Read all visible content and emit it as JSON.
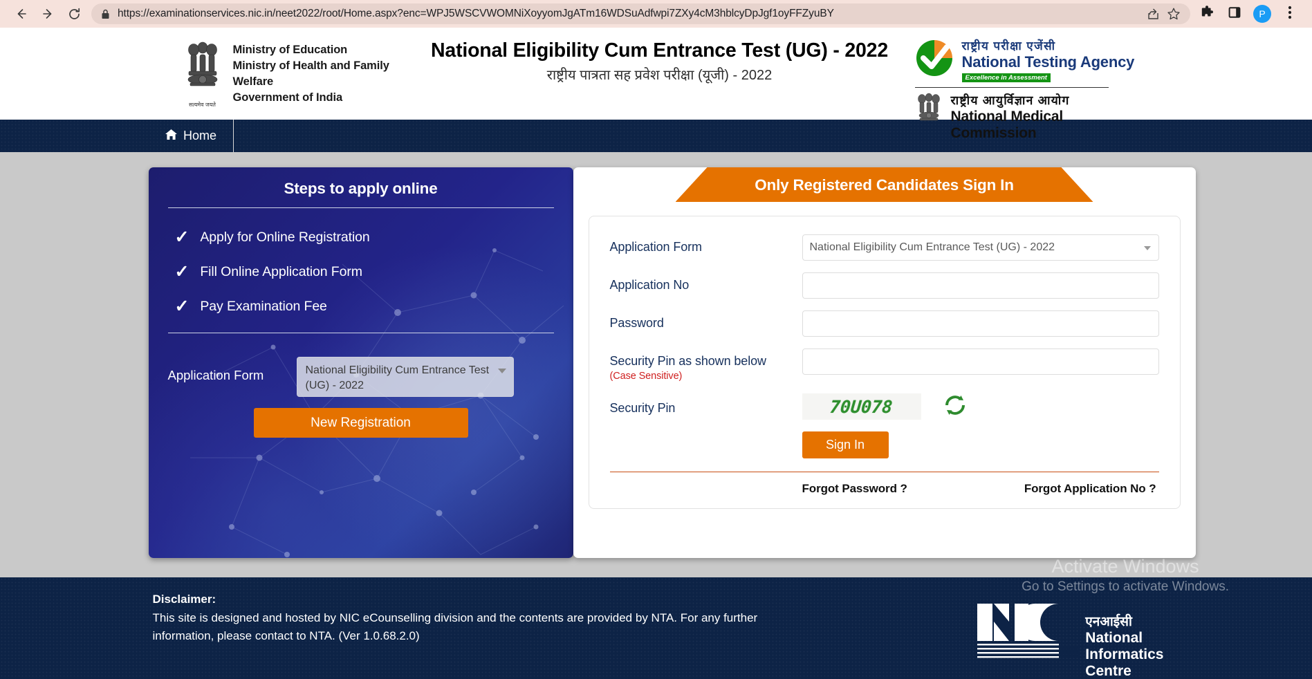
{
  "browser": {
    "url": "https://examinationservices.nic.in/neet2022/root/Home.aspx?enc=WPJ5WSCVWOMNiXoyyomJgATm16WDSuAdfwpi7ZXy4cM3hblcyDpJgf1oyFFZyuBY",
    "back_icon": "back-arrow-icon",
    "forward_icon": "forward-arrow-icon",
    "reload_icon": "reload-icon",
    "lock_icon": "lock-icon",
    "share_icon": "share-icon",
    "bookmark_icon": "star-icon",
    "extensions_icon": "puzzle-icon",
    "sidepanel_icon": "side-panel-icon",
    "profile_initial": "P",
    "menu_icon": "three-dot-menu-icon"
  },
  "header": {
    "ministry_line1": "Ministry of Education",
    "ministry_line2": "Ministry of Health and Family Welfare",
    "ministry_line3": "Government of India",
    "emblem_motto": "सत्यमेव जयते",
    "title_en": "National Eligibility Cum Entrance Test (UG) - 2022",
    "title_hi": "राष्ट्रीय पात्रता सह प्रवेश परीक्षा (यूजी) - 2022",
    "nta_hi": "राष्ट्रीय परीक्षा एजेंसी",
    "nta_en": "National Testing Agency",
    "nta_tagline": "Excellence in Assessment",
    "nmc_hi": "राष्ट्रीय आयुर्विज्ञान आयोग",
    "nmc_en": "National Medical Commission"
  },
  "navbar": {
    "home_label": "Home"
  },
  "left_panel": {
    "title": "Steps to apply online",
    "steps": [
      "Apply for Online Registration",
      "Fill Online Application Form",
      "Pay Examination Fee"
    ],
    "check_glyph": "✓",
    "form_label": "Application Form",
    "form_value": "National Eligibility Cum Entrance Test (UG) - 2022",
    "new_registration_label": "New Registration"
  },
  "sign_in": {
    "ribbon_title": "Only Registered Candidates Sign In",
    "application_form_label": "Application Form",
    "application_form_value": "National Eligibility Cum Entrance Test (UG) - 2022",
    "application_no_label": "Application No",
    "application_no_value": "",
    "application_no_placeholder": "",
    "password_label": "Password",
    "password_value": "",
    "password_placeholder": "",
    "security_pin_label": "Security Pin as shown below",
    "case_sensitive_note": "(Case Sensitive)",
    "security_pin_value": "",
    "security_pin_placeholder": "",
    "captcha_label": "Security Pin",
    "captcha_text": "70U078",
    "refresh_icon": "refresh-captcha-icon",
    "sign_in_label": "Sign In",
    "forgot_password_label": "Forgot Password ?",
    "forgot_application_no_label": "Forgot Application No ?"
  },
  "footer": {
    "disclaimer_title": "Disclaimer:",
    "disclaimer_body": "This site is designed and hosted by NIC eCounselling division and the contents are provided by NTA. For any further information, please contact to NTA. (Ver 1.0.68.2.0)",
    "nic_hi": "एनआईसी",
    "nic_en_line1": "National",
    "nic_en_line2": "Informatics",
    "nic_en_line3": "Centre"
  },
  "watermark": {
    "title": "Activate Windows",
    "subtitle": "Go to Settings to activate Windows."
  },
  "colors": {
    "orange": "#e57200",
    "navy": "#0d2346",
    "panel_blue": "#23248a",
    "label_blue": "#16305c",
    "red_note": "#cf2020",
    "captcha_green": "#2f8f2f"
  }
}
